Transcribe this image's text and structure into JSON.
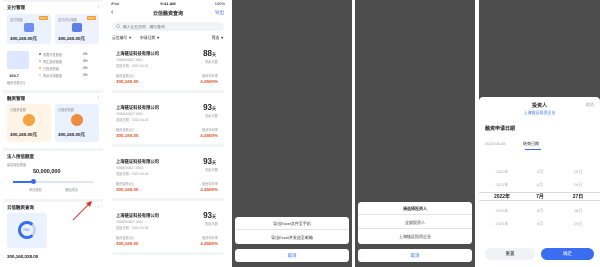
{
  "dashboard": {
    "sections": [
      {
        "title": "支付管理",
        "cards": [
          {
            "label": "支付额度",
            "tag": "2022",
            "amount": "300,160.00元"
          },
          {
            "label": "支付成功笔数",
            "tag": "2022",
            "amount": "300,160.00元"
          }
        ]
      },
      {
        "title": "融资管理",
        "cards": [
          {
            "label": "已融资金额",
            "tag": "",
            "amount": "300,160.00元"
          },
          {
            "label": "已融资笔数",
            "tag": "",
            "amount": "300,160.00元"
          }
        ]
      }
    ],
    "mid_big": "103.7",
    "mid_label": "融资总额(万)",
    "legend": [
      "重要开发额度",
      "再生投资额度",
      "已投资额度",
      "剩余可用额度"
    ],
    "legend_vals": [
      "0%",
      "0%",
      "0%",
      "0%"
    ],
    "credit_title": "法人授信额度",
    "credit_label": "最高授信额度",
    "credit_amount": "50,000,000",
    "credit_sub": [
      "申请授信",
      "授信成功"
    ],
    "bottom_title": "云信融资查询",
    "bottom_amount": "300,160,028.00",
    "bottom_pct": "75%"
  },
  "query": {
    "status_time": "9:41 AM",
    "status_left": "iPad",
    "status_right": "100%",
    "title": "云信融资查询",
    "back": "‹",
    "export": "导出",
    "search_placeholder": "输入企业名称、编号查询",
    "filters": [
      "云信编号 ▼",
      "申请日期 ▼",
      "筛选 ▼"
    ],
    "items": [
      {
        "company": "上海链证科技有限公司",
        "code": "YKB8000627-0001",
        "date": "发起日期：2022-04-03",
        "score": "88",
        "score_unit": "天",
        "score_label": "剩余天数",
        "l1": "融资金额(元)",
        "v1": "300,160.00",
        "l2": "融资年利率",
        "v2": "4.4500%"
      },
      {
        "company": "上海链证科技有限公司",
        "code": "YKB8000627-0002",
        "date": "发起日期：2022-04-03",
        "score": "93",
        "score_unit": "天",
        "score_label": "剩余天数",
        "l1": "融资金额(元)",
        "v1": "300,160.00",
        "l2": "融资年利率",
        "v2": "4.4500%"
      },
      {
        "company": "上海链证科技有限公司",
        "code": "YKB8000627-0003",
        "date": "发起日期：2022-04-03",
        "score": "93",
        "score_unit": "天",
        "score_label": "剩余天数",
        "l1": "融资金额(元)",
        "v1": "300,160.00",
        "l2": "融资年利率",
        "v2": "4.4500%"
      },
      {
        "company": "上海链证科技有限公司",
        "code": "YKB8000627-0004",
        "date": "发起日期：2022-04-03",
        "score": "93",
        "score_unit": "天",
        "score_label": "剩余天数",
        "l1": "融资金额(元)",
        "v1": "300,160.00",
        "l2": "融资年利率",
        "v2": "4.4500%"
      }
    ]
  },
  "export_sheet": {
    "options": [
      "导出Excel文件至手机",
      "导出Excel并发送至邮箱"
    ],
    "cancel": "取消"
  },
  "investor_sheet": {
    "title": "请选择投资人",
    "options": [
      "全部投资人",
      "上海链证投资企业"
    ],
    "cancel": "取消"
  },
  "date_picker": {
    "title": "投资人",
    "subtitle": "上海链证投资企业",
    "close": "取消",
    "section": "融资申请日期",
    "start": "2022-05-05",
    "end_label": "结束日期",
    "years": [
      "2020年",
      "2021年",
      "2022年",
      "2023年",
      "2024年"
    ],
    "months": [
      "5月",
      "6月",
      "7月",
      "8月",
      "9月"
    ],
    "days": [
      "25日",
      "26日",
      "27日",
      "28日",
      "29日"
    ],
    "reset": "重置",
    "confirm": "确定"
  }
}
